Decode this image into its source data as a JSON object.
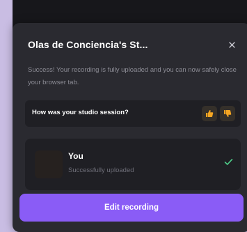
{
  "modal": {
    "title": "Olas de Conciencia's St...",
    "success_message": "Success! Your recording is fully uploaded and you can now safely close your browser tab."
  },
  "feedback": {
    "question": "How was your studio session?",
    "thumbs_up_icon": "thumbs-up-icon",
    "thumbs_down_icon": "thumbs-down-icon",
    "accent_color": "#f5a623"
  },
  "participant": {
    "name": "You",
    "status": "Successfully uploaded",
    "check_color": "#4fd18b"
  },
  "actions": {
    "edit_label": "Edit recording",
    "accent_color": "#8a5cf6"
  }
}
